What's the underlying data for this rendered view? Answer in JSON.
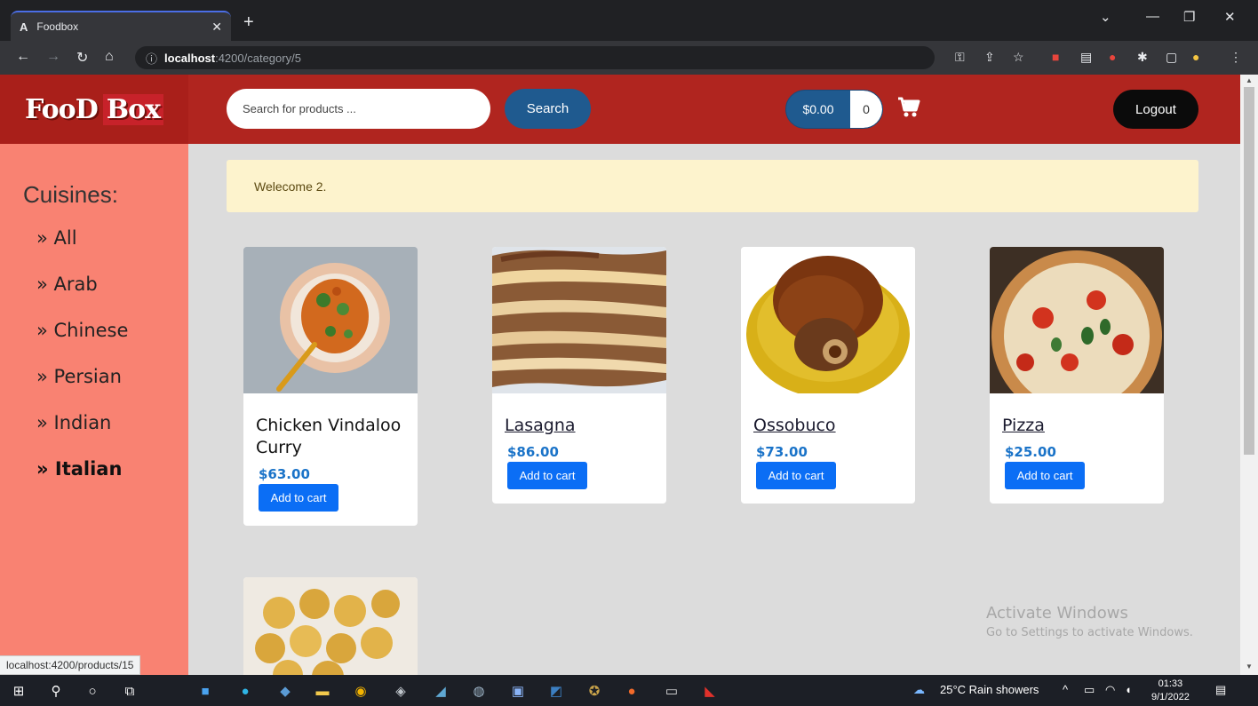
{
  "browser": {
    "tab_title": "Foodbox",
    "tab_favicon": "A",
    "url_host": "localhost",
    "url_path": ":4200/category/5",
    "status_url": "localhost:4200/products/15"
  },
  "header": {
    "logo_left": "FooD",
    "logo_right": "Box",
    "search_placeholder": "Search for products ...",
    "search_button": "Search",
    "cart_amount": "$0.00",
    "cart_count": "0",
    "logout_button": "Logout"
  },
  "sidebar": {
    "title": "Cuisines:",
    "items": [
      {
        "label": "» All"
      },
      {
        "label": "» Arab"
      },
      {
        "label": "» Chinese"
      },
      {
        "label": "» Persian"
      },
      {
        "label": "» Indian"
      },
      {
        "label": "» Italian"
      }
    ],
    "active_index": 5
  },
  "welcome": "Welecome 2.",
  "products": [
    {
      "name": "Chicken Vindaloo Curry",
      "price": "$63.00",
      "button": "Add to cart",
      "image_icon": "curry-bowl-image"
    },
    {
      "name": "Lasagna",
      "price": "$86.00",
      "button": "Add to cart",
      "image_icon": "lasagna-image"
    },
    {
      "name": "Ossobuco",
      "price": "$73.00",
      "button": "Add to cart",
      "image_icon": "ossobuco-image"
    },
    {
      "name": "Pizza",
      "price": "$25.00",
      "button": "Add to cart",
      "image_icon": "pizza-image"
    }
  ],
  "watermark": {
    "line1": "Activate Windows",
    "line2": "Go to Settings to activate Windows."
  },
  "taskbar": {
    "weather": "25°C  Rain showers",
    "time": "01:33",
    "date": "9/1/2022"
  },
  "colors": {
    "header": "#b0251f",
    "sidebar": "#f98272",
    "accent": "#0b6ef5"
  }
}
